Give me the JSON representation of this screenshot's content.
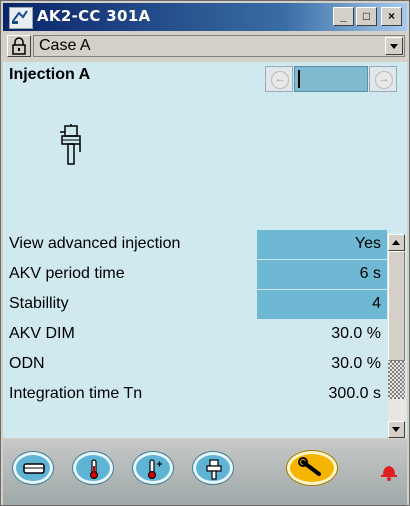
{
  "window": {
    "title": "AK2-CC 301A",
    "app_icon": "controller-icon",
    "controls": [
      "minimize-icon",
      "maximize-icon",
      "close-icon"
    ]
  },
  "case_selector": {
    "lock_icon": "lock-icon",
    "selected": "Case A"
  },
  "section": {
    "title": "Injection A",
    "nav_prev_icon": "arrow-left-icon",
    "nav_next_icon": "arrow-right-icon",
    "valve_icon": "injection-valve-icon"
  },
  "params": [
    {
      "label": "View advanced injection",
      "value": "Yes",
      "editable": true
    },
    {
      "label": "AKV period time",
      "value": "6 s",
      "editable": true
    },
    {
      "label": "Stabillity",
      "value": "4",
      "editable": true
    },
    {
      "label": "AKV DIM",
      "value": "30.0 %",
      "editable": false
    },
    {
      "label": "ODN",
      "value": "30.0 %",
      "editable": false
    },
    {
      "label": "Integration time Tn",
      "value": "300.0 s",
      "editable": false
    }
  ],
  "bottom_nav": [
    "case-icon",
    "thermometer-fan-icon",
    "thermometer-icon",
    "valve-icon",
    "wrench-icon",
    "alarm-bell-icon"
  ],
  "colors": {
    "background": "#cfe9ef",
    "editable_value": "#6fb8d3",
    "title_bar": "#0a246a",
    "wrench_button": "#f4b400",
    "alarm": "#e02020"
  }
}
